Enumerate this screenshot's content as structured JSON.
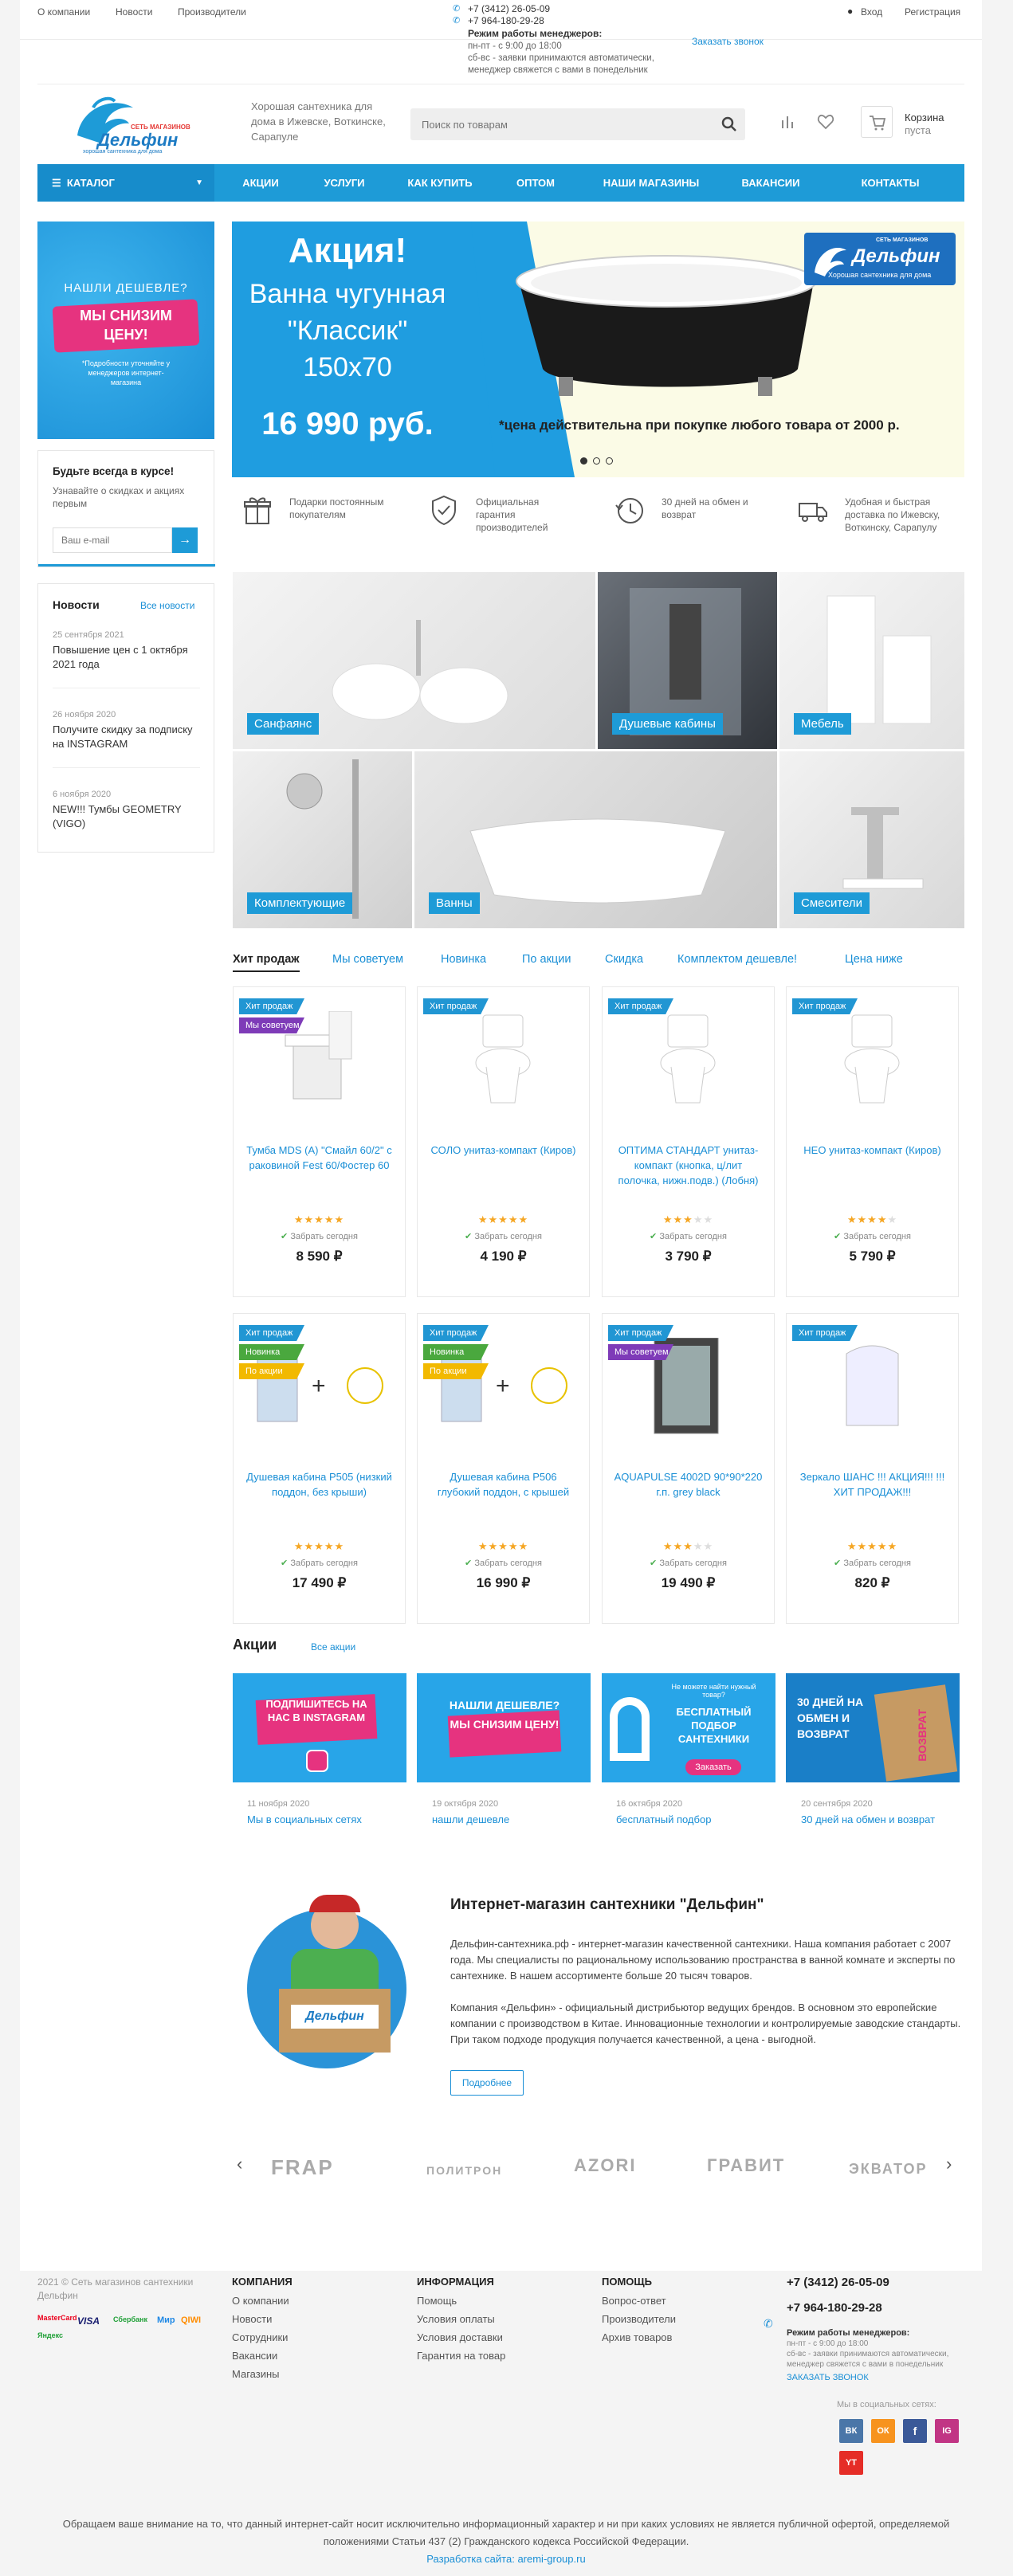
{
  "topbar": {
    "links": [
      "О компании",
      "Новости",
      "Производители"
    ],
    "phone1": "+7 (3412) 26-05-09",
    "phone2": "+7 964-180-29-28",
    "schedule_title": "Режим работы менеджеров:",
    "schedule_lines": [
      "пн-пт - с 9:00 до 18:00",
      "сб-вс - заявки принимаются автоматически,",
      "менеджер свяжется с вами в понедельник"
    ],
    "callback": "Заказать звонок",
    "login": "Вход",
    "register": "Регистрация"
  },
  "header": {
    "logo_top": "СЕТЬ МАГАЗИНОВ",
    "logo_name": "Дельфин",
    "logo_sub": "хорошая сантехника для дома",
    "slogan": "Хорошая сантехника для дома в Ижевске, Воткинске, Сарапуле",
    "search_placeholder": "Поиск по товарам",
    "cart_label": "Корзина",
    "cart_state": "пуста"
  },
  "menu": {
    "catalog": "КАТАЛОГ",
    "items": [
      "АКЦИИ",
      "УСЛУГИ",
      "КАК КУПИТЬ",
      "ОПТОМ",
      "НАШИ МАГАЗИНЫ",
      "ВАКАНСИИ",
      "КОНТАКТЫ"
    ]
  },
  "sidebar": {
    "promo_line1": "НАШЛИ ДЕШЕВЛЕ?",
    "promo_line2": "МЫ СНИЗИМ",
    "promo_line3": "ЦЕНУ!",
    "promo_note": "*Подробности уточняйте у менеджеров интернет-магазина",
    "subscribe_title": "Будьте всегда в курсе!",
    "subscribe_text": "Узнавайте о скидках и акциях первым",
    "email_placeholder": "Ваш e-mail",
    "news_title": "Новости",
    "news_all": "Все новости",
    "news": [
      {
        "date": "25 сентября 2021",
        "title": "Повышение цен с 1 октября 2021 года"
      },
      {
        "date": "26 ноября 2020",
        "title": "Получите скидку за подписку на INSTAGRAM"
      },
      {
        "date": "6 ноября 2020",
        "title": "NEW!!! Тумбы GEOMETRY (VIGO)"
      }
    ]
  },
  "banner": {
    "title": "Акция!",
    "line2": "Ванна чугунная",
    "line3": "\"Классик\"",
    "line4": "150х70",
    "price": "16 990 руб.",
    "note": "*цена действительна при покупке любого товара от 2000 р.",
    "logo_top": "СЕТЬ МАГАЗИНОВ",
    "logo_name": "Дельфин",
    "logo_sub": "Хорошая сантехника для дома"
  },
  "features": [
    {
      "icon": "gift-icon",
      "text": "Подарки постоянным покупателям"
    },
    {
      "icon": "shield-check-icon",
      "text": "Официальная гарантия производителей"
    },
    {
      "icon": "clock-return-icon",
      "text": "30 дней на обмен и возврат"
    },
    {
      "icon": "truck-icon",
      "text": "Удобная и быстрая доставка по Ижевску, Воткинску, Сарапулу"
    }
  ],
  "categories": [
    "Санфаянс",
    "Душевые кабины",
    "Мебель",
    "Комплектующие",
    "Ванны",
    "Смесители"
  ],
  "tabs": [
    "Хит продаж",
    "Мы советуем",
    "Новинка",
    "По акции",
    "Скидка",
    "Комплектом дешевле!",
    "Цена ниже"
  ],
  "products": [
    {
      "name": "Тумба MDS (A) \"Смайл 60/2\" с раковиной Fest 60/Фостер 60",
      "price": "8 590 ₽",
      "badges": [
        "Хит продаж",
        "Мы советуем"
      ],
      "rating": 5,
      "stock": "Забрать сегодня",
      "icon": "vanity-icon"
    },
    {
      "name": "СОЛО унитаз-компакт (Киров)",
      "price": "4 190 ₽",
      "badges": [
        "Хит продаж"
      ],
      "rating": 5,
      "stock": "Забрать сегодня",
      "icon": "toilet-icon"
    },
    {
      "name": "ОПТИМА СТАНДАРТ унитаз-компакт (кнопка, ц/лит полочка, нижн.подв.) (Лобня)",
      "price": "3 790 ₽",
      "badges": [
        "Хит продаж"
      ],
      "rating": 3,
      "stock": "Забрать сегодня",
      "icon": "toilet-icon"
    },
    {
      "name": "НЕО унитаз-компакт (Киров)",
      "price": "5 790 ₽",
      "badges": [
        "Хит продаж"
      ],
      "rating": 4,
      "stock": "Забрать сегодня",
      "icon": "toilet-icon"
    },
    {
      "name": "Душевая кабина Р505 (низкий поддон, без крыши)",
      "price": "17 490 ₽",
      "badges": [
        "Хит продаж",
        "Новинка",
        "По акции"
      ],
      "rating": 5,
      "stock": "Забрать сегодня",
      "icon": "shower-bundle-icon"
    },
    {
      "name": "Душевая кабина Р506 глубокий поддон, с крышей",
      "price": "16 990 ₽",
      "badges": [
        "Хит продаж",
        "Новинка",
        "По акции"
      ],
      "rating": 5,
      "stock": "Забрать сегодня",
      "icon": "shower-bundle-icon"
    },
    {
      "name": "AQUAPULSE 4002D 90*90*220 г.п. grey black",
      "price": "19 490 ₽",
      "badges": [
        "Хит продаж",
        "Мы советуем"
      ],
      "rating": 3,
      "stock": "Забрать сегодня",
      "icon": "shower-cabin-icon"
    },
    {
      "name": "Зеркало ШАНС !!! АКЦИЯ!!! !!!ХИТ ПРОДАЖ!!!",
      "price": "820 ₽",
      "badges": [
        "Хит продаж"
      ],
      "rating": 5,
      "stock": "Забрать сегодня",
      "icon": "mirror-icon"
    }
  ],
  "promos": {
    "title": "Акции",
    "all": "Все акции",
    "items": [
      {
        "date": "11 ноября 2020",
        "title": "Мы в социальных сетях",
        "img_text": "ПОДПИШИТЕСЬ НА НАС В INSTAGRAM"
      },
      {
        "date": "19 октября 2020",
        "title": "нашли дешевле",
        "img_text": "НАШЛИ ДЕШЕВЛЕ? МЫ СНИЗИМ ЦЕНУ!"
      },
      {
        "date": "16 октября 2020",
        "title": "бесплатный подбор",
        "img_text": "БЕСПЛАТНЫЙ ПОДБОР САНТЕХНИКИ",
        "img_btn": "Заказать",
        "img_small": "Не можете найти нужный товар?"
      },
      {
        "date": "20 сентября 2020",
        "title": "30 дней на обмен и возврат",
        "img_text": "30 ДНЕЙ НА ОБМЕН И ВОЗВРАТ",
        "img_box": "ВОЗВРАТ"
      }
    ]
  },
  "about": {
    "title": "Интернет-магазин сантехники \"Дельфин\"",
    "p1": "Дельфин-сантехника.рф - интернет-магазин качественной сантехники. Наша компания работает с 2007 года. Мы специалисты по рациональному использованию пространства в ванной комнате и эксперты по сантехнике. В нашем ассортименте больше 20 тысяч товаров.",
    "p2": "Компания «Дельфин» - официальный дистрибьютор ведущих брендов. В основном это европейские компании с производством в Китае. Инновационные технологии и контролируемые заводские стандарты. При таком подходе продукция получается качественной, а цена - выгодной.",
    "more": "Подробнее",
    "box_logo": "Дельфин"
  },
  "brands": [
    "FRAP",
    "ПОЛИТРОН",
    "AZORI",
    "ГРАВИТ",
    "ЭКВАТОР"
  ],
  "footer": {
    "copyright": "2021 © Сеть магазинов сантехники Дельфин",
    "payments": [
      "MasterCard",
      "VISA",
      "Сбербанк",
      "Мир",
      "QIWI",
      "Яндекс"
    ],
    "col1_title": "КОМПАНИЯ",
    "col1": [
      "О компании",
      "Новости",
      "Сотрудники",
      "Вакансии",
      "Магазины"
    ],
    "col2_title": "ИНФОРМАЦИЯ",
    "col2": [
      "Помощь",
      "Условия оплаты",
      "Условия доставки",
      "Гарантия на товар"
    ],
    "col3_title": "ПОМОЩЬ",
    "col3": [
      "Вопрос-ответ",
      "Производители",
      "Архив товаров"
    ],
    "phone1": "+7 (3412) 26-05-09",
    "phone2": "+7 964-180-29-28",
    "schedule_title": "Режим работы менеджеров:",
    "schedule_lines": [
      "пн-пт - с 9:00 до 18:00",
      "сб-вс - заявки принимаются автоматически,",
      "менеджер свяжется с вами в понедельник"
    ],
    "callback": "ЗАКАЗАТЬ ЗВОНОК",
    "social_title": "Мы в социальных сетях:",
    "socials": [
      "ВК",
      "ОК",
      "f",
      "IG",
      "YT"
    ],
    "legal": "Обращаем ваше внимание на то, что данный интернет-сайт носит исключительно информационный характер и ни при каких условиях не является публичной офертой, определяемой положениями Статьи 437 (2) Гражданского кодекса Российской Федерации.",
    "dev": "Разработка сайта: aremi-group.ru"
  },
  "colors": {
    "accent": "#1e9bd7",
    "hit": "#2196d3",
    "sovetuem": "#7e3bb8",
    "new": "#4aa83e",
    "akcia": "#f2b900",
    "star": "#f5a623"
  }
}
